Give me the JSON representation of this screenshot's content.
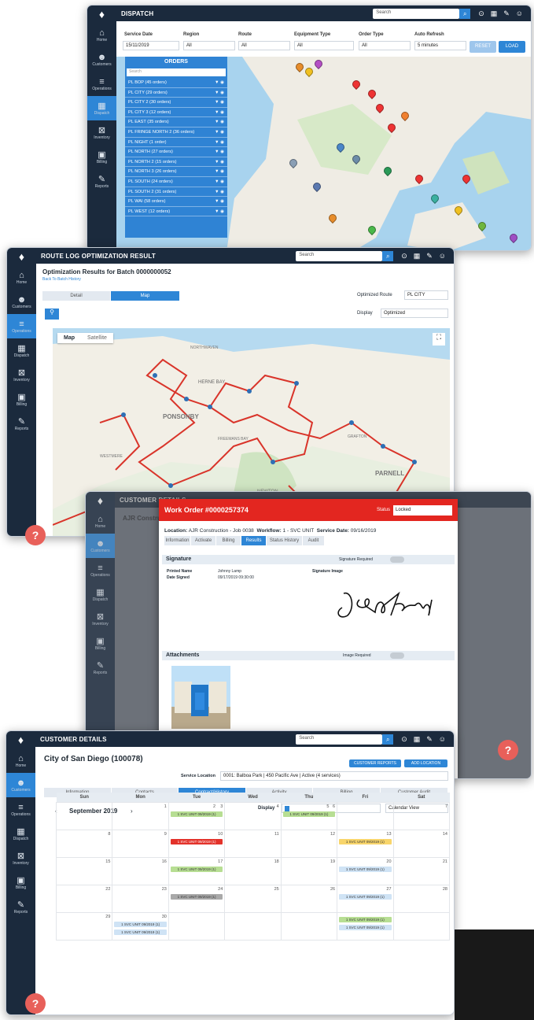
{
  "sidebar": {
    "logo": "♦",
    "items": [
      {
        "glyph": "⌂",
        "label": "Home"
      },
      {
        "glyph": "☻",
        "label": "Customers"
      },
      {
        "glyph": "≡",
        "label": "Operations"
      },
      {
        "glyph": "▦",
        "label": "Dispatch"
      },
      {
        "glyph": "⊠",
        "label": "Inventory"
      },
      {
        "glyph": "▣",
        "label": "Billing"
      },
      {
        "glyph": "✎",
        "label": "Reports"
      }
    ]
  },
  "topbar_icons": [
    "⊙",
    "▦",
    "✎",
    "☺"
  ],
  "dispatch": {
    "title": "DISPATCH",
    "search_placeholder": "Search",
    "filters": {
      "service_date_label": "Service Date",
      "service_date": "15/11/2019",
      "region_label": "Region",
      "region": "All",
      "route_label": "Route",
      "route": "All",
      "equipment_label": "Equipment Type",
      "equipment": "All",
      "order_type_label": "Order Type",
      "order_type": "All",
      "auto_refresh_label": "Auto Refresh",
      "auto_refresh": "5 minutes"
    },
    "reset_label": "RESET",
    "load_label": "LOAD",
    "orders_title": "ORDERS",
    "orders_search": "Search",
    "orders": [
      "PL BOP (45 orders)",
      "PL CITY (29 orders)",
      "PL CITY 2 (30 orders)",
      "PL CITY 3 (12 orders)",
      "PL EAST (35 orders)",
      "PL FRINGE NORTH 2 (36 orders)",
      "PL NIGHT (1 order)",
      "PL NORTH (27 orders)",
      "PL NORTH 2 (15 orders)",
      "PL NORTH 3 (26 orders)",
      "PL SOUTH (24 orders)",
      "PL SOUTH 2 (31 orders)",
      "PL WAI (58 orders)",
      "PL WEST (12 orders)"
    ]
  },
  "route_log": {
    "title": "ROUTE LOG OPTIMIZATION RESULT",
    "search_placeholder": "Search",
    "heading": "Optimization Results for Batch 0000000052",
    "back_link": "Back To Batch History",
    "tab_detail": "Detail",
    "tab_map": "Map",
    "optimized_route_label": "Optimized Route",
    "optimized_route": "PL CITY",
    "display_label": "Display",
    "display_value": "Optimized",
    "map_tab": "Map",
    "satellite_tab": "Satellite",
    "map_places": [
      "NORTHWAVEN",
      "HERNE BAY",
      "PONSONBY",
      "WESTMERE",
      "NEWTON",
      "PARNELL",
      "FREEMANS BAY",
      "GRAFTON"
    ]
  },
  "work_order": {
    "bg_title": "CUSTOMER DETAILS",
    "bg_customer": "AJR Constru",
    "title": "Work Order #0000257374",
    "status_label": "Status",
    "status_value": "Locked",
    "location_label": "Location:",
    "location": "AJR Construction - Job 0038",
    "workflow_label": "Workflow:",
    "workflow": "1 - SVC UNIT",
    "service_date_label": "Service Date:",
    "service_date": "09/16/2019",
    "tabs": [
      "Information",
      "Activate",
      "Billing",
      "Results",
      "Status History",
      "Audit"
    ],
    "signature_heading": "Signature",
    "signature_required": "Signature Required",
    "printed_name_label": "Printed Name",
    "printed_name": "Johnny Lamp",
    "date_signed_label": "Date Signed",
    "date_signed": "09/17/2019 09:30:00",
    "signature_image_label": "Signature Image",
    "attachments_heading": "Attachments",
    "image_required": "Image Required"
  },
  "customer": {
    "title": "CUSTOMER DETAILS",
    "search_placeholder": "Search",
    "name": "City of San Diego (100078)",
    "customer_reports_label": "CUSTOMER REPORTS",
    "add_location_label": "ADD LOCATION",
    "service_location_label": "Service Location",
    "service_location": "0001: Balboa Park | 450 Pacific Ave | Active (4 services)",
    "tabs": [
      "Information",
      "Contacts",
      "Contract/History",
      "Activity",
      "Billing",
      "Customer Audit"
    ],
    "month": "September 2019",
    "display_label": "Display",
    "calendar_view": "Calendar View",
    "weekdays": [
      "Sun",
      "Mon",
      "Tue",
      "Wed",
      "Thu",
      "Fri",
      "Sat"
    ],
    "weeks": [
      [
        "",
        "",
        "2",
        "3",
        "4",
        "5",
        "6",
        "7"
      ],
      [
        "8",
        "9",
        "10",
        "11",
        "12",
        "13",
        "14"
      ],
      [
        "15",
        "16",
        "17",
        "18",
        "19",
        "20",
        "21"
      ],
      [
        "22",
        "23",
        "24",
        "25",
        "26",
        "27",
        "28"
      ],
      [
        "29",
        "30",
        "",
        "",
        "",
        "",
        ""
      ]
    ],
    "event_label": "1 SVC UNIT 09/2019 (1)"
  },
  "help_glyph": "?",
  "colors": {
    "sidebar": "#1b2a3d",
    "accent": "#2e86d6",
    "work_order_header": "#e32620",
    "help": "#e8605a"
  }
}
